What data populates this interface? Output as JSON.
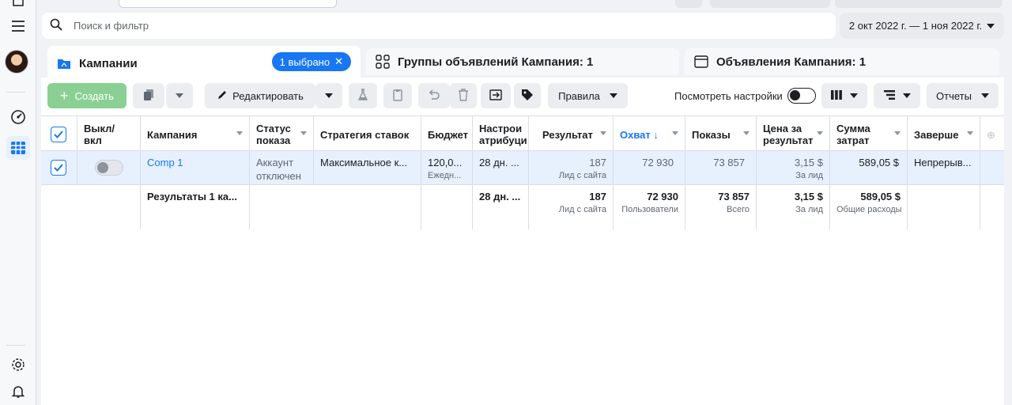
{
  "search": {
    "placeholder": "Поиск и фильтр"
  },
  "date_range": "2 окт 2022 г. — 1 ноя 2022 г.",
  "tabs": [
    {
      "label": "Кампании",
      "badge": "1 выбрано"
    },
    {
      "label": "Группы объявлений Кампания: 1"
    },
    {
      "label": "Объявления Кампания: 1"
    }
  ],
  "toolbar": {
    "create": "Создать",
    "edit": "Редактировать",
    "rules": "Правила",
    "view_settings": "Посмотреть настройки",
    "reports": "Отчеты"
  },
  "table": {
    "headers": {
      "onoff": [
        "Выкл/",
        "вкл"
      ],
      "campaign": "Кампания",
      "status": [
        "Статус",
        "показа"
      ],
      "strategy": "Стратегия ставок",
      "budget": "Бюджет",
      "attribution": [
        "Настрои",
        "атрибуци"
      ],
      "result": "Результат",
      "reach": "Охват",
      "impressions": "Показы",
      "cost_per_result": [
        "Цена за",
        "результат"
      ],
      "spend": [
        "Сумма",
        "затрат"
      ],
      "end": "Заверше"
    },
    "row": {
      "campaign": "Comp 1",
      "status": [
        "Аккаунт",
        "отключен"
      ],
      "strategy": "Максимальное к...",
      "budget": "120,0...",
      "budget_sub": "Ежедн...",
      "attribution": "28 дн. ...",
      "result": "187",
      "result_sub": "Лид с сайта",
      "reach": "72 930",
      "impressions": "73 857",
      "cost_per_result": "3,15 $",
      "cost_sub": "За лид",
      "spend": "589,05 $",
      "end": "Непрерыв..."
    },
    "summary": {
      "label": "Результаты 1 ка...",
      "attribution": "28 дн. ...",
      "result": "187",
      "result_sub": "Лид с сайта",
      "reach": "72 930",
      "reach_sub": "Пользователи",
      "impressions": "73 857",
      "impressions_sub": "Всего",
      "cost_per_result": "3,15 $",
      "cost_sub": "За лид",
      "spend": "589,05 $",
      "spend_sub": "Общие расходы"
    }
  },
  "colors": {
    "accent": "#1877f2",
    "create_button": "#8ad093",
    "selected_row": "#e7f0fd"
  }
}
